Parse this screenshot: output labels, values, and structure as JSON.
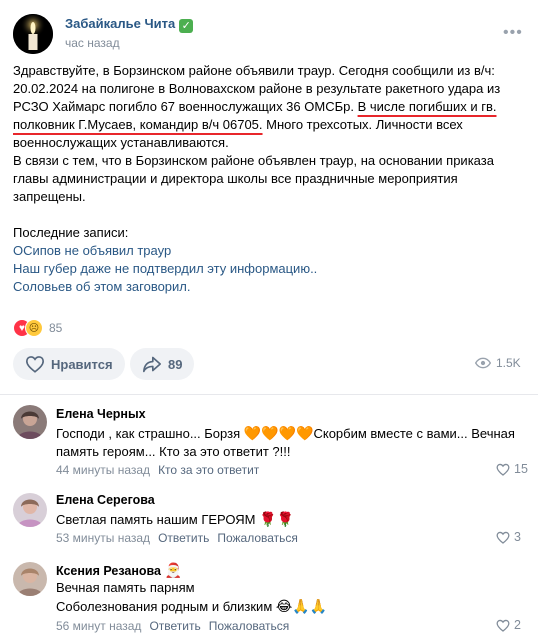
{
  "post": {
    "author": "Забайкалье Чита",
    "verified_badge": "✓",
    "time": "час назад",
    "body": {
      "line1": "Здравствуйте, в Борзинском районе объявили траур. Сегодня сообщили из в/ч: 20.02.2024 на полигоне в Волновахском районе в результате ракетного удара из РСЗО Хаймарс погибло 67 военнослужащих 36 ОМСБр. ",
      "underlined": "В числе погибших и гв. полковник Г.Мусаев, командир в/ч 06705.",
      "after_underline": " Много трехсотых. Личности всех военнослужащих устанавливаются.",
      "line2": "В связи с тем, что в Борзинском районе объявлен траур, на основании приказа главы администрации и директора школы все праздничные мероприятия запрещены."
    },
    "recent_label": "Последние записи:",
    "recent_links": [
      "ОСипов не объявил траур",
      "Наш губер даже не подтвердил эту информацию..",
      "Соловьев об этом заговорил."
    ],
    "reactions_count": "85",
    "like_label": "Нравится",
    "share_count": "89",
    "views": "1.5K"
  },
  "comments": [
    {
      "name": "Елена Черных",
      "text_line1": "Господи , как страшно... Борзя ",
      "text_hearts": "🧡🧡🧡🧡",
      "text_line1_end": "Скорбим вместе с вами... Вечная память героям... Кто за это ответит ?!!!",
      "time": "44 минуты назад",
      "reply": "Кто за это ответит",
      "likes": "15"
    },
    {
      "name": "Елена Серегова",
      "text_line1": "Светлая память нашим ГЕРОЯМ ",
      "emoji": "🌹🌹",
      "time": "53 минуты назад",
      "reply": "Ответить",
      "report": "Пожаловаться",
      "likes": "3"
    },
    {
      "name": "Ксения Резанова",
      "name_emoji": "🎅",
      "text_line1": "Вечная память парням",
      "text_line2": "Соболезнования родным и близким ",
      "emoji": "😂🙏🙏",
      "time": "56 минут назад",
      "reply": "Ответить",
      "report": "Пожаловаться",
      "likes": "2"
    }
  ],
  "colors": {
    "link": "#2a5885",
    "muted": "#818c99",
    "underline": "#e8262b",
    "button_bg": "#f0f2f5"
  },
  "icons": [
    "candle-icon",
    "more-icon",
    "heart-icon",
    "share-icon",
    "eye-icon"
  ]
}
